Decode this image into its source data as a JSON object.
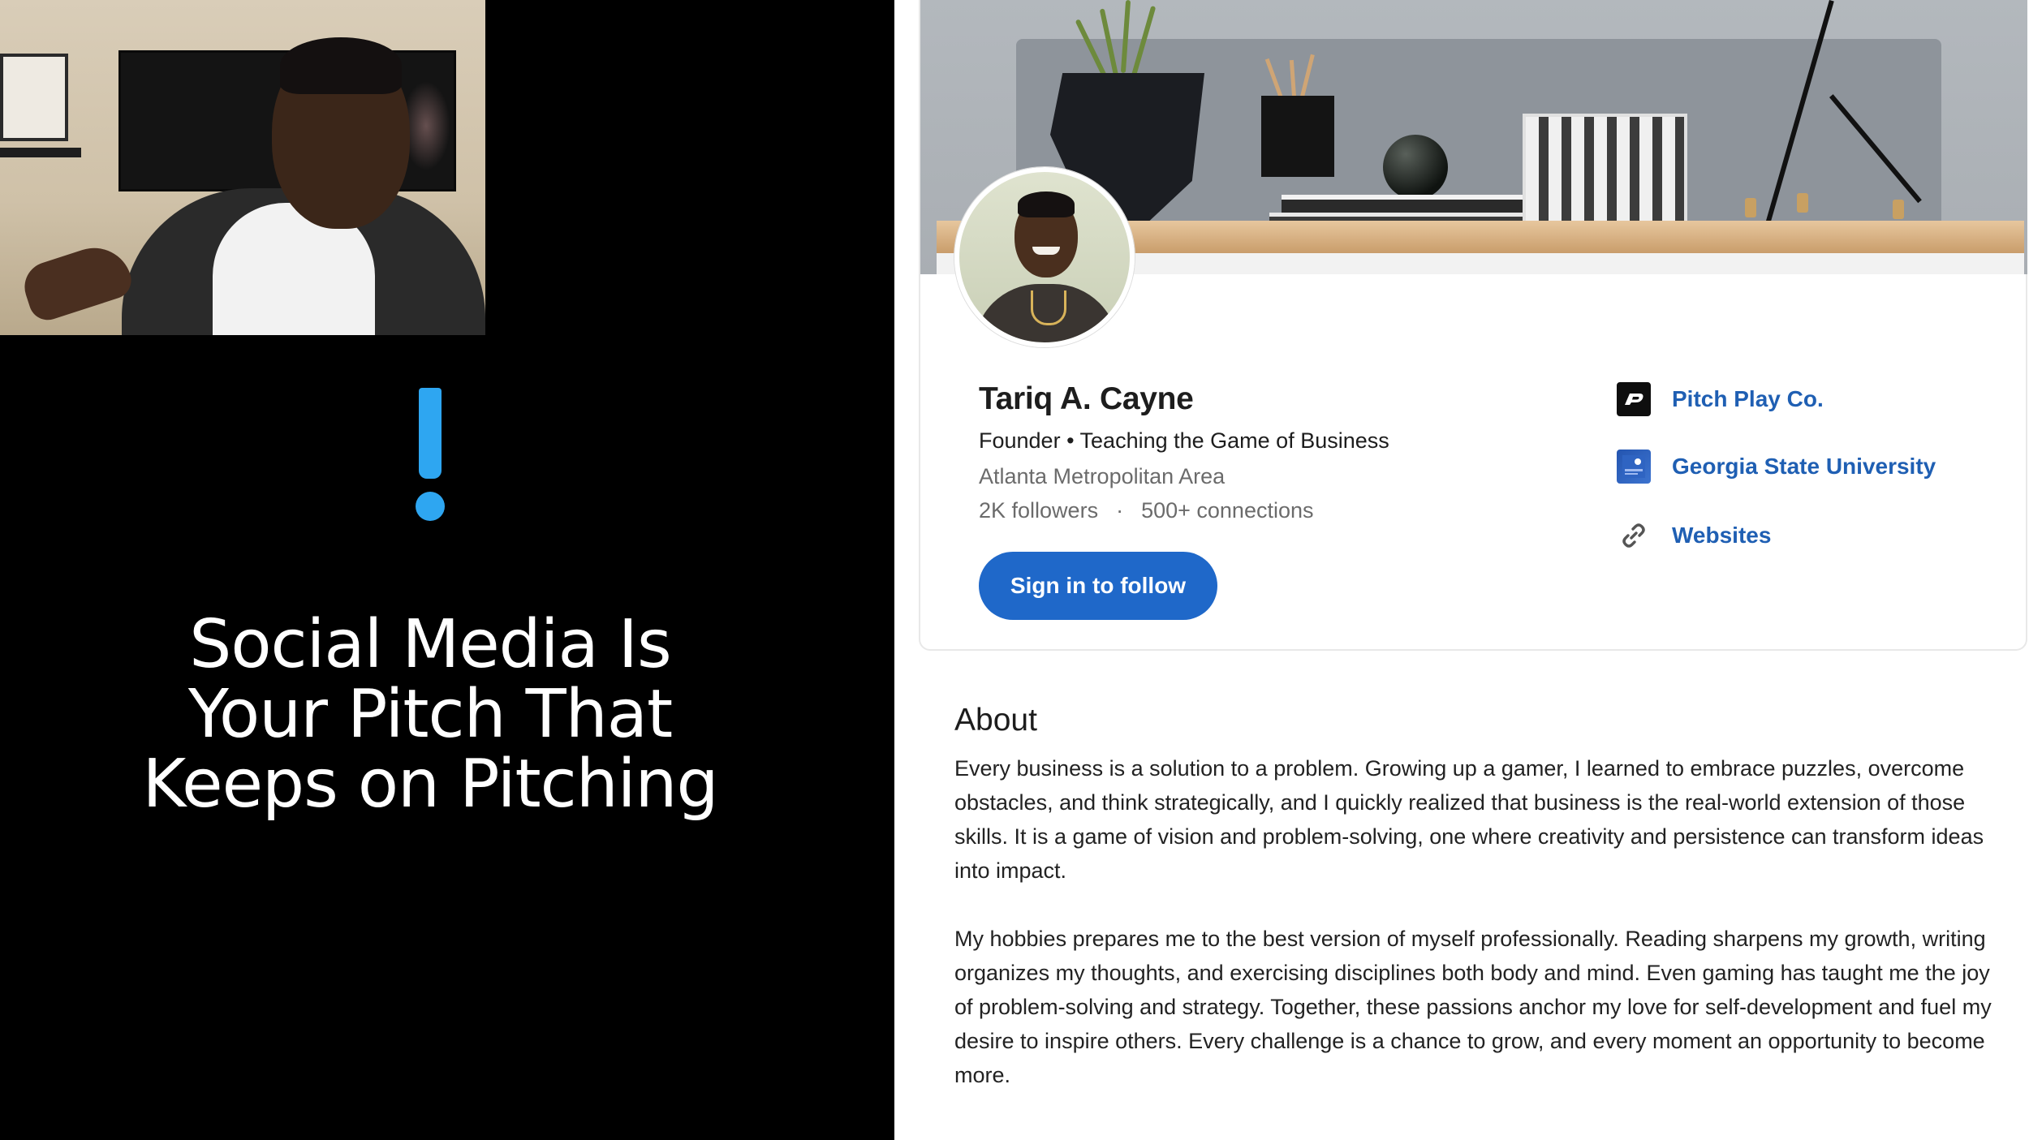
{
  "slide": {
    "title_lines": [
      "Social Media Is",
      "Your Pitch That",
      "Keeps on Pitching"
    ],
    "accent_color": "#2ea6f1",
    "accent_icon": "exclamation-icon"
  },
  "profile": {
    "name": "Tariq A. Cayne",
    "headline": "Founder • Teaching the Game of Business",
    "location": "Atlanta Metropolitan Area",
    "followers": "2K followers",
    "stats_separator": "·",
    "connections": "500+ connections",
    "follow_button": "Sign in to follow",
    "primary_color": "#1f68c9",
    "link_color": "#1f5fb3",
    "links": [
      {
        "label": "Pitch Play Co.",
        "icon": "company-logo-icon"
      },
      {
        "label": "Georgia State University",
        "icon": "university-logo-icon"
      },
      {
        "label": "Websites",
        "icon": "link-icon"
      }
    ]
  },
  "about": {
    "title": "About",
    "paragraphs": [
      "Every business is a solution to a problem. Growing up a gamer, I learned to embrace puzzles, overcome obstacles, and think strategically, and I quickly realized that business is the real-world extension of those skills. It is a game of vision and problem-solving, one where creativity and persistence can transform ideas into impact.",
      "My hobbies prepares me to the best version of myself professionally. Reading sharpens my growth, writing organizes my thoughts, and exercising disciplines both body and mind. Even gaming has taught me the joy of problem-solving and strategy. Together, these passions anchor my love for self-development and fuel my desire to inspire others. Every challenge is a chance to grow, and every moment an opportunity to become more."
    ]
  }
}
